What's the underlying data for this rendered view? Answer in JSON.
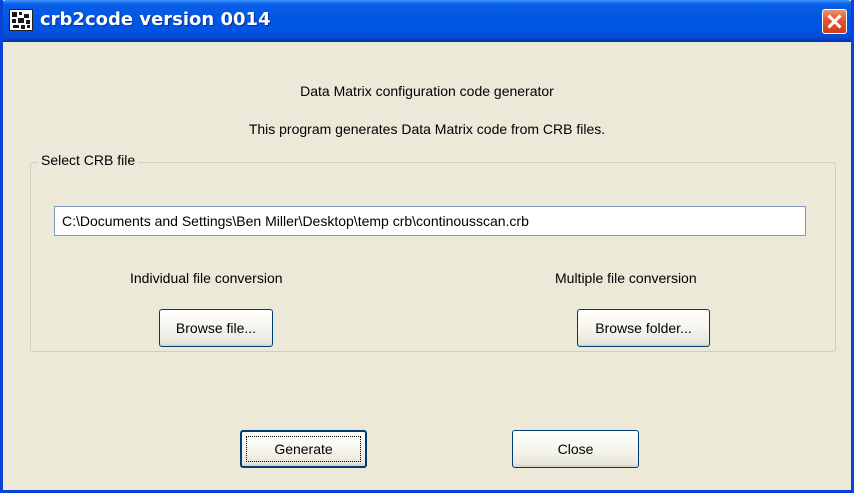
{
  "window": {
    "title": "crb2code version 0014",
    "close_icon": "close-icon"
  },
  "header": {
    "heading": "Data Matrix configuration code generator",
    "description": "This program generates Data Matrix code from CRB files."
  },
  "select_group": {
    "legend": "Select CRB file",
    "file_path_value": "C:\\Documents and Settings\\Ben Miller\\Desktop\\temp crb\\continousscan.crb",
    "individual_label": "Individual file conversion",
    "multiple_label": "Multiple file conversion",
    "browse_file_label": "Browse file...",
    "browse_folder_label": "Browse folder..."
  },
  "actions": {
    "generate_label": "Generate",
    "close_label": "Close"
  },
  "colors": {
    "titlebar": "#0055E5",
    "dialog_bg": "#ECE9D8",
    "close_button": "#E2562F",
    "button_border": "#003C74",
    "input_border": "#7F9DB9"
  }
}
